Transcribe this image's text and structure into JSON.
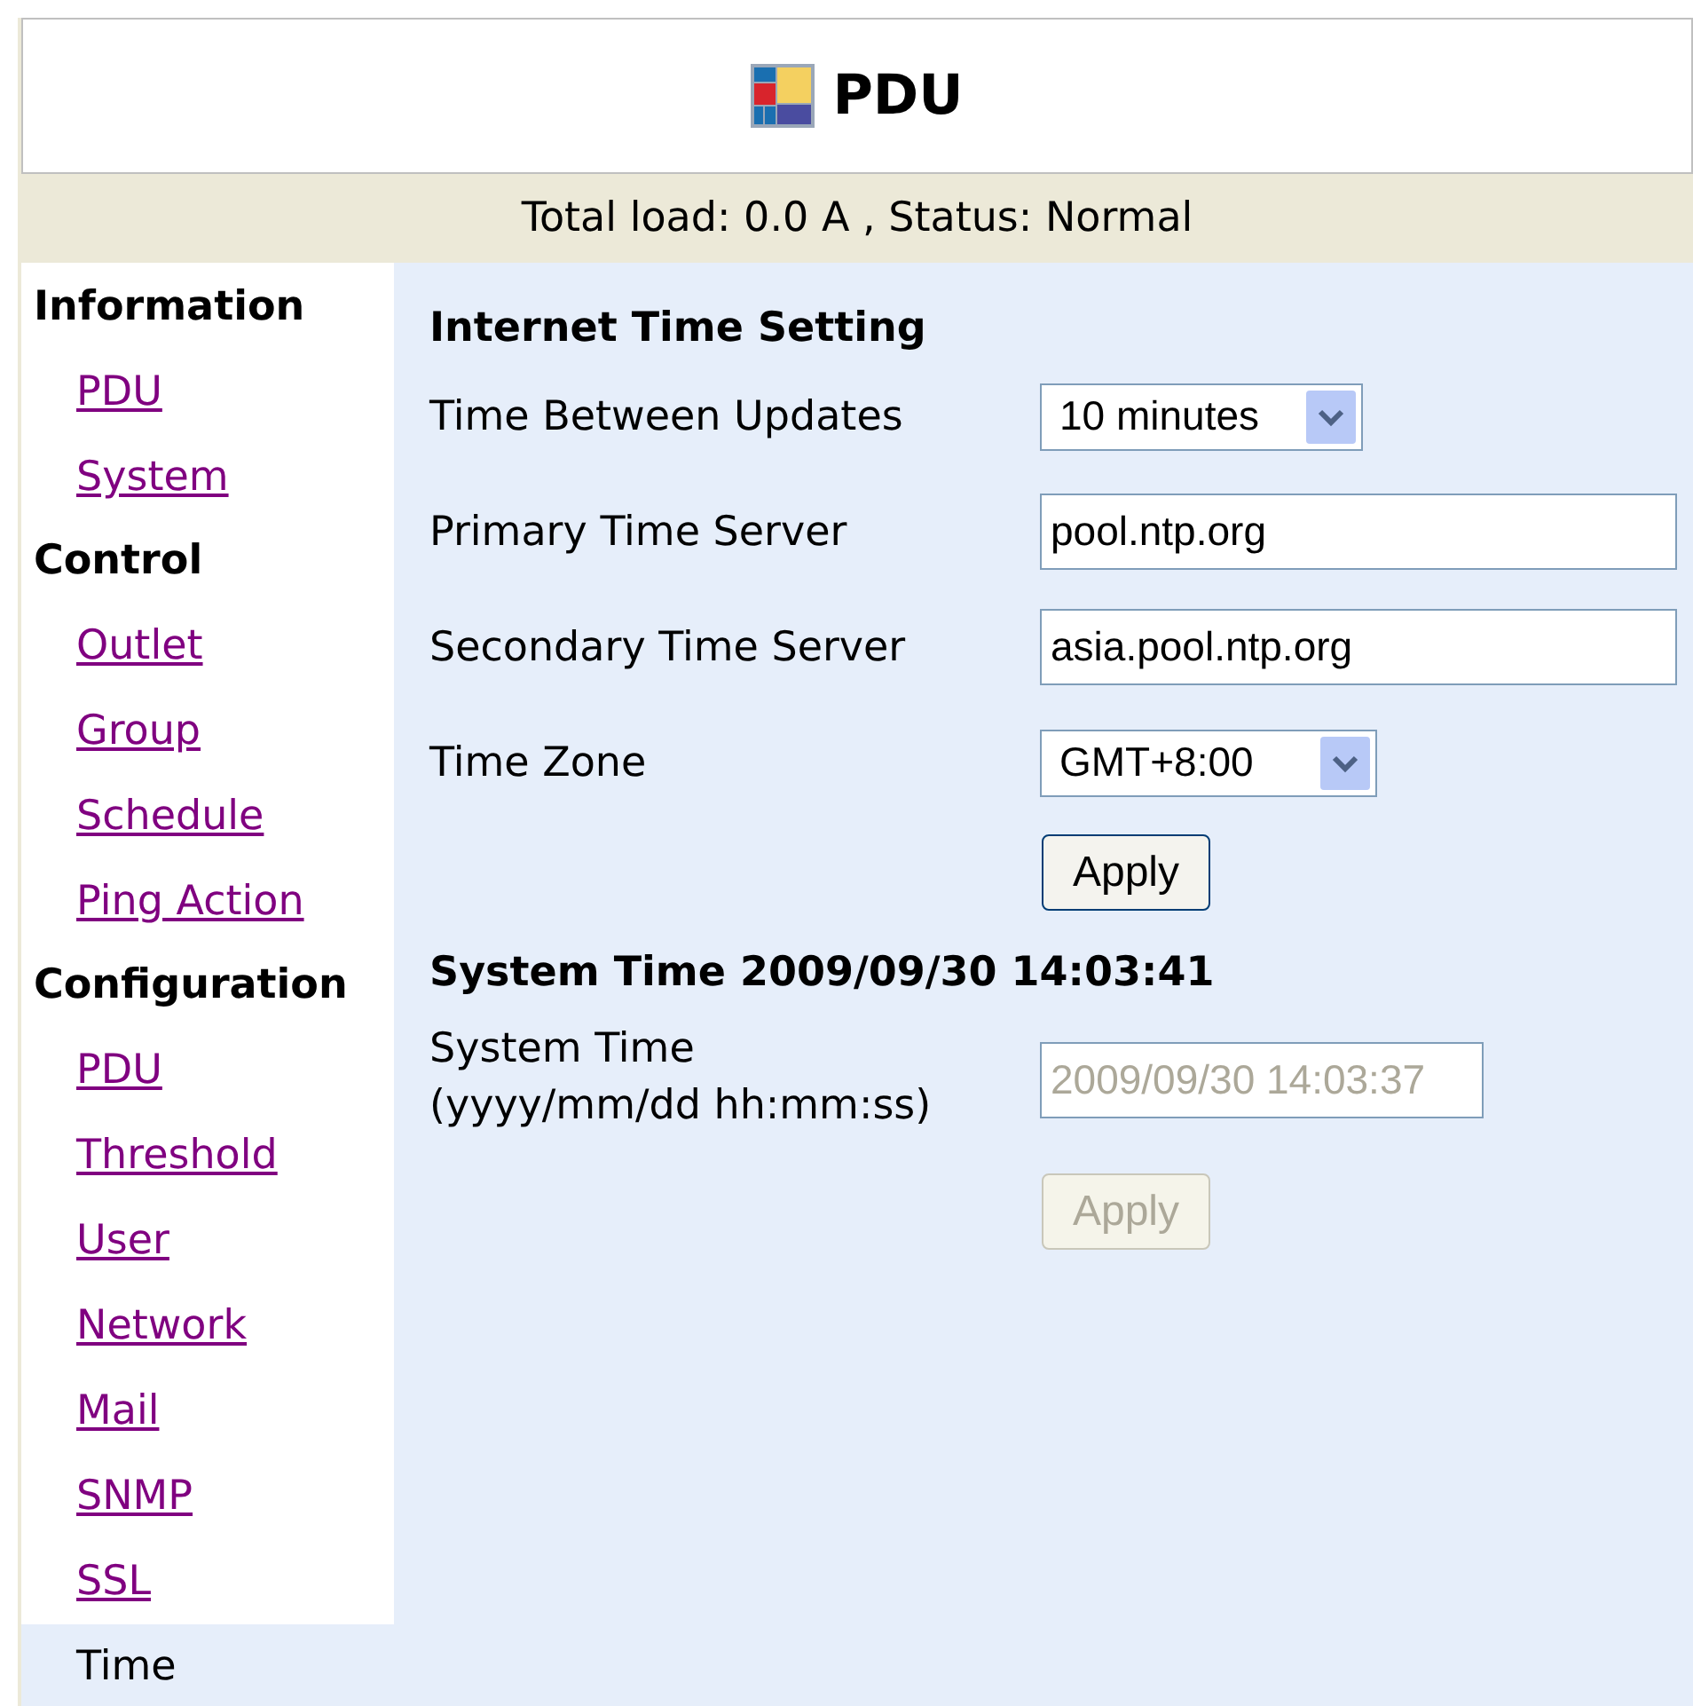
{
  "header": {
    "title": "PDU"
  },
  "status_bar": "Total load: 0.0 A , Status: Normal",
  "sidebar": {
    "sections": [
      {
        "title": "Information",
        "items": [
          {
            "label": "PDU",
            "selected": false
          },
          {
            "label": "System",
            "selected": false
          }
        ]
      },
      {
        "title": "Control",
        "items": [
          {
            "label": "Outlet",
            "selected": false
          },
          {
            "label": "Group",
            "selected": false
          },
          {
            "label": "Schedule",
            "selected": false
          },
          {
            "label": "Ping Action",
            "selected": false
          }
        ]
      },
      {
        "title": "Configuration",
        "items": [
          {
            "label": "PDU",
            "selected": false
          },
          {
            "label": "Threshold",
            "selected": false
          },
          {
            "label": "User",
            "selected": false
          },
          {
            "label": "Network",
            "selected": false
          },
          {
            "label": "Mail",
            "selected": false
          },
          {
            "label": "SNMP",
            "selected": false
          },
          {
            "label": "SSL",
            "selected": false
          },
          {
            "label": "Time",
            "selected": true
          }
        ]
      }
    ]
  },
  "sections": [
    {
      "title": "Internet Time Setting",
      "fields": [
        {
          "kind": "select",
          "label": "Time Between Updates",
          "value": "10 minutes",
          "disabled": false
        },
        {
          "kind": "text",
          "label": "Primary Time Server",
          "value": "pool.ntp.org",
          "disabled": false
        },
        {
          "kind": "text",
          "label": "Secondary Time Server",
          "value": "asia.pool.ntp.org",
          "disabled": false
        },
        {
          "kind": "select",
          "label": "Time Zone",
          "value": "GMT+8:00",
          "disabled": false
        }
      ],
      "apply_button": {
        "label": "Apply",
        "disabled": false
      }
    },
    {
      "title": "System Time 2009/09/30 14:03:41",
      "fields": [
        {
          "kind": "text",
          "label": "System Time",
          "hint": "(yyyy/mm/dd hh:mm:ss)",
          "value": "2009/09/30 14:03:37",
          "disabled": true
        }
      ],
      "apply_button": {
        "label": "Apply",
        "disabled": true
      }
    }
  ]
}
